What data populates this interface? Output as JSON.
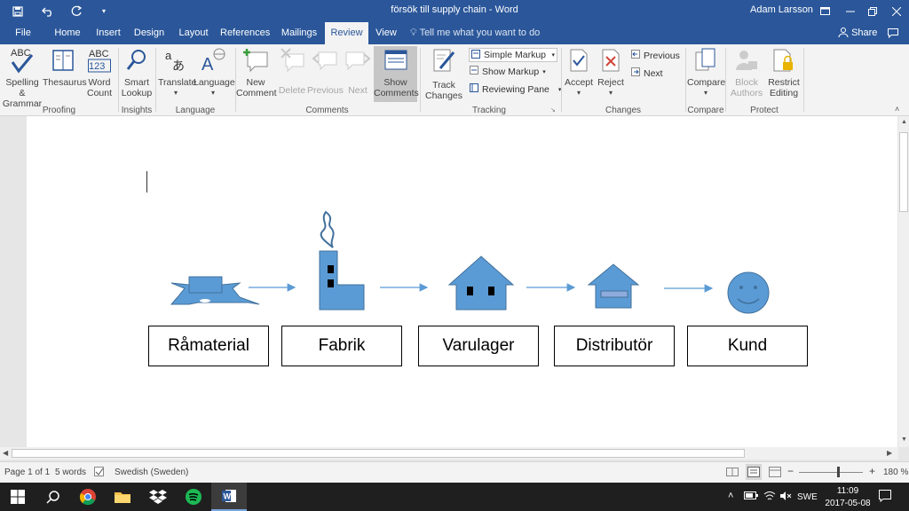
{
  "titlebar": {
    "title": "försök till supply chain - Word",
    "user": "Adam Larsson",
    "quick_access": [
      "save-icon",
      "undo-icon",
      "redo-icon",
      "customize-icon"
    ]
  },
  "tabs": {
    "items": [
      "File",
      "Home",
      "Insert",
      "Design",
      "Layout",
      "References",
      "Mailings",
      "Review",
      "View"
    ],
    "active": "Review",
    "tell_me": "Tell me what you want to do",
    "share": "Share"
  },
  "ribbon": {
    "proofing": {
      "spelling_l1": "Spelling &",
      "spelling_l2": "Grammar",
      "thesaurus": "Thesaurus",
      "word_count_l1": "Word",
      "word_count_l2": "Count",
      "label": "Proofing"
    },
    "insights": {
      "smart_l1": "Smart",
      "smart_l2": "Lookup",
      "label": "Insights"
    },
    "language": {
      "translate": "Translate",
      "language": "Language",
      "label": "Language"
    },
    "comments": {
      "new_l1": "New",
      "new_l2": "Comment",
      "delete": "Delete",
      "previous": "Previous",
      "next": "Next",
      "show_l1": "Show",
      "show_l2": "Comments",
      "label": "Comments"
    },
    "tracking": {
      "track_l1": "Track",
      "track_l2": "Changes",
      "simple_markup": "Simple Markup",
      "show_markup": "Show Markup",
      "reviewing_pane": "Reviewing Pane",
      "label": "Tracking"
    },
    "changes": {
      "accept": "Accept",
      "reject": "Reject",
      "previous": "Previous",
      "next": "Next",
      "label": "Changes"
    },
    "compare": {
      "compare": "Compare",
      "label": "Compare"
    },
    "protect": {
      "block_l1": "Block",
      "block_l2": "Authors",
      "restrict_l1": "Restrict",
      "restrict_l2": "Editing",
      "label": "Protect"
    }
  },
  "document": {
    "nodes": [
      "Råmaterial",
      "Fabrik",
      "Varulager",
      "Distributör",
      "Kund"
    ],
    "shape_color": "#5b9bd5",
    "shape_border": "#41719c"
  },
  "status": {
    "page": "Page 1 of 1",
    "words": "5 words",
    "language": "Swedish (Sweden)",
    "zoom": "180 %",
    "zoom_level": 180
  },
  "taskbar": {
    "time": "11:09",
    "date": "2017-05-08",
    "input_lang": "SWE",
    "apps": [
      "windows-start-icon",
      "search-icon",
      "chrome-icon",
      "file-explorer-icon",
      "dropbox-icon",
      "spotify-icon",
      "word-icon"
    ]
  }
}
